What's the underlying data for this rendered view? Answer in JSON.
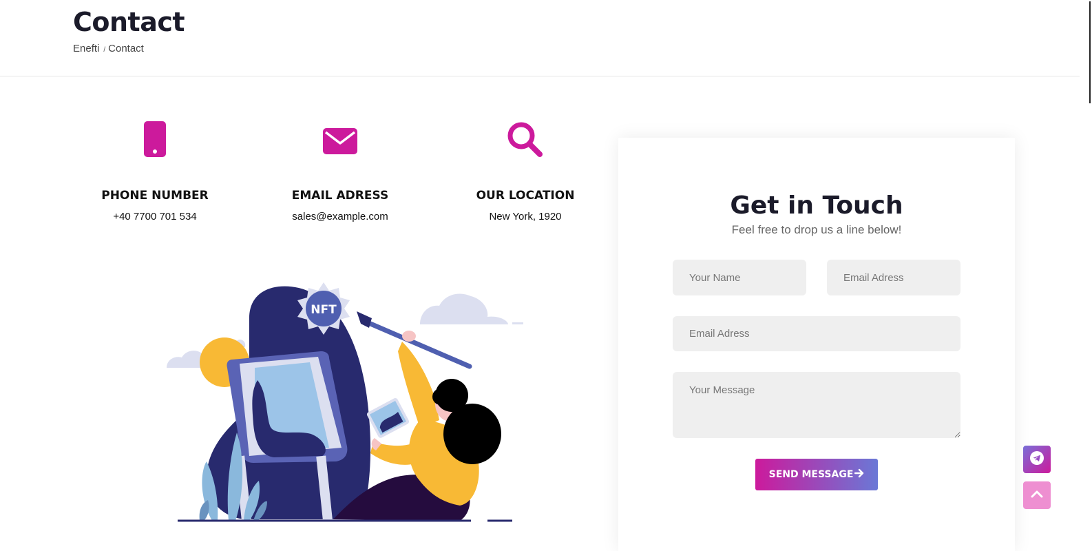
{
  "header": {
    "title": "Contact",
    "breadcrumb": {
      "home": "Enefti",
      "separator": "/",
      "current": "Contact"
    }
  },
  "info": [
    {
      "icon": "phone-icon",
      "heading": "PHONE NUMBER",
      "value": "+40 7700 701 534"
    },
    {
      "icon": "envelope-icon",
      "heading": "EMAIL ADRESS",
      "value": "sales@example.com"
    },
    {
      "icon": "search-icon",
      "heading": "OUR LOCATION",
      "value": "New York, 1920"
    }
  ],
  "illustration": {
    "badge_text": "NFT"
  },
  "form": {
    "title": "Get in Touch",
    "subtitle": "Feel free to drop us a line below!",
    "name_placeholder": "Your Name",
    "email_placeholder": "Email Adress",
    "email2_placeholder": "Email Adress",
    "message_placeholder": "Your Message",
    "send_label": "SEND MESSAGE"
  },
  "colors": {
    "accent": "#cc1a9c",
    "accent_light": "#ee8fd1",
    "gradient_end": "#6a78d6"
  }
}
